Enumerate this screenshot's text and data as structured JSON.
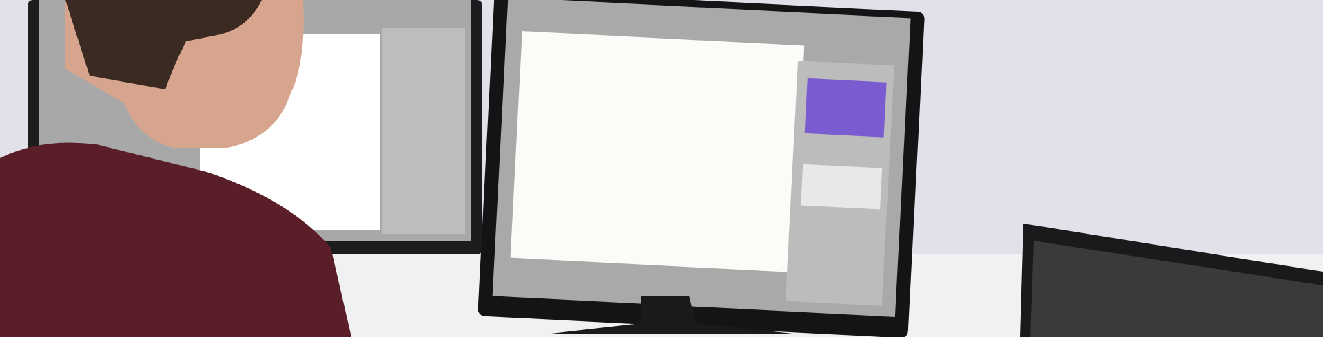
{
  "photo": {
    "kind": "office-desk-photo"
  }
}
